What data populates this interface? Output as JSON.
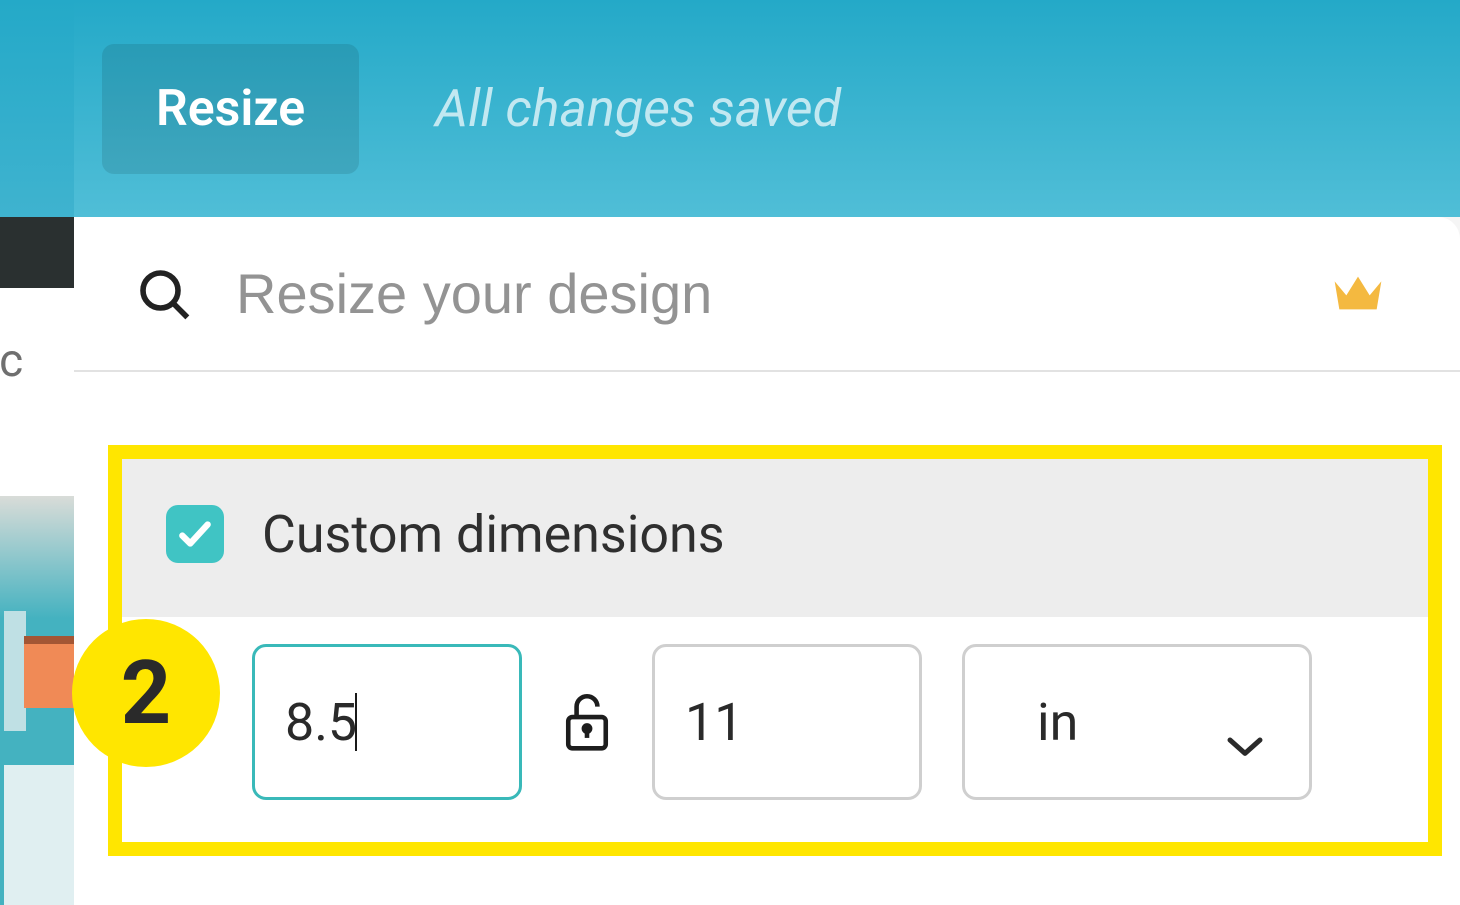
{
  "topbar": {
    "resize_label": "Resize",
    "status_text": "All changes saved"
  },
  "search": {
    "placeholder": "Resize your design"
  },
  "custom_dimensions": {
    "label": "Custom dimensions",
    "checked": true,
    "width_value": "8.5",
    "height_value": "11",
    "unit_value": "in"
  },
  "annotation": {
    "step_number": "2"
  },
  "obscured_text": "rc",
  "icons": {
    "search": "search-icon",
    "crown": "crown-icon",
    "check": "check-icon",
    "lock_open": "lock-open-icon",
    "chevron_down": "chevron-down-icon"
  }
}
